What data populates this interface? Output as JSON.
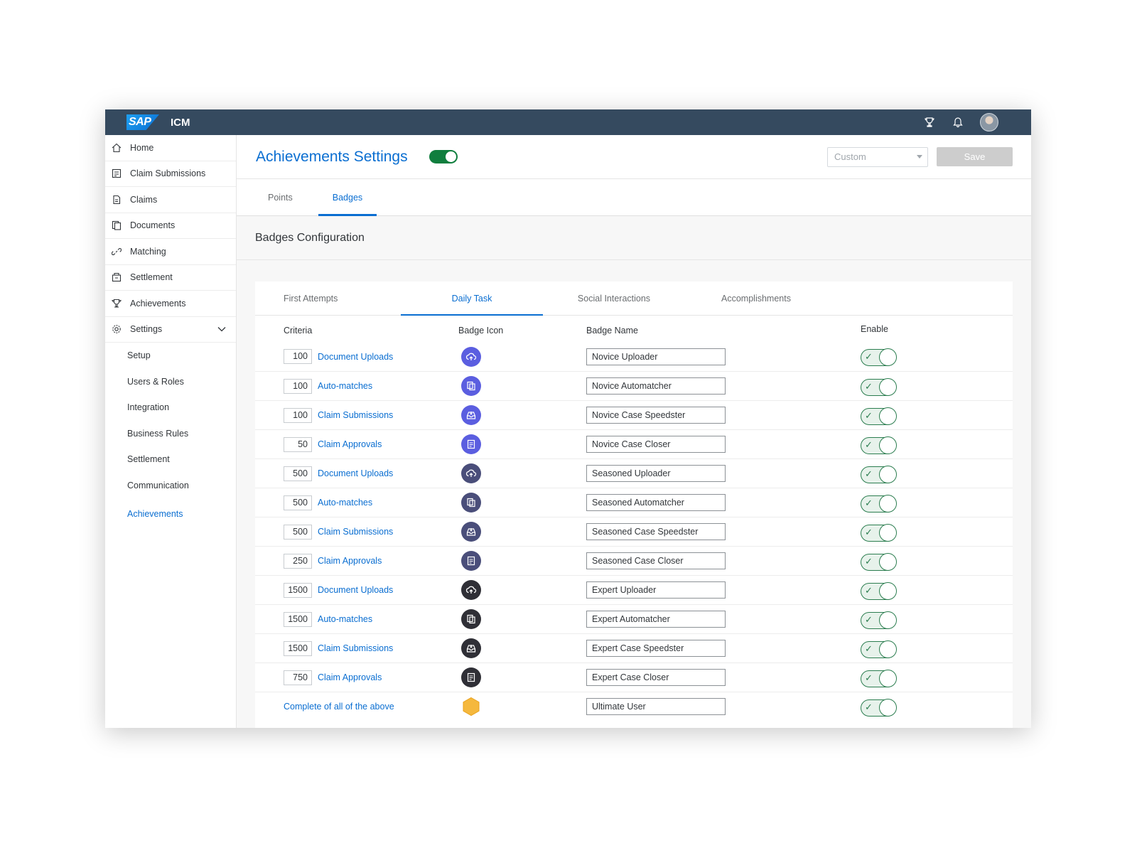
{
  "shell": {
    "logo_text": "SAP",
    "app_name": "ICM"
  },
  "sidebar": {
    "items": [
      {
        "label": "Home",
        "icon": "home-icon"
      },
      {
        "label": "Claim Submissions",
        "icon": "claim-submissions-icon"
      },
      {
        "label": "Claims",
        "icon": "claims-icon"
      },
      {
        "label": "Documents",
        "icon": "documents-icon"
      },
      {
        "label": "Matching",
        "icon": "link-icon"
      },
      {
        "label": "Settlement",
        "icon": "settlement-icon"
      },
      {
        "label": "Achievements",
        "icon": "trophy-icon"
      },
      {
        "label": "Settings",
        "icon": "gear-icon"
      }
    ],
    "sub_items": [
      "Setup",
      "Users & Roles",
      "Integration",
      "Business Rules",
      "Settlement",
      "Communication"
    ],
    "active_sub_item": "Achievements"
  },
  "header": {
    "title": "Achievements Settings",
    "select_value": "Custom",
    "save_label": "Save"
  },
  "tabs": [
    "Points",
    "Badges"
  ],
  "section_title": "Badges Configuration",
  "subtabs": [
    "First Attempts",
    "Daily Task",
    "Social Interactions",
    "Accomplishments"
  ],
  "columns": {
    "criteria": "Criteria",
    "badge_icon": "Badge Icon",
    "badge_name": "Badge Name",
    "enable": "Enable"
  },
  "colors": {
    "novice": "#5b5ee0",
    "seasoned": "#4a4e7a",
    "expert": "#2f2f36",
    "ultimate": "#f5b83d",
    "accent": "#0a6ed1",
    "success": "#107e3e"
  },
  "rows": [
    {
      "count": "100",
      "criterion": "Document Uploads",
      "name": "Novice Uploader",
      "icon": "upload-icon",
      "tier": "novice"
    },
    {
      "count": "100",
      "criterion": "Auto-matches",
      "name": "Novice Automatcher",
      "icon": "documents-icon",
      "tier": "novice"
    },
    {
      "count": "100",
      "criterion": "Claim Submissions",
      "name": "Novice Case Speedster",
      "icon": "inbox-icon",
      "tier": "novice"
    },
    {
      "count": "50",
      "criterion": "Claim Approvals",
      "name": "Novice Case Closer",
      "icon": "approval-icon",
      "tier": "novice"
    },
    {
      "count": "500",
      "criterion": "Document Uploads",
      "name": "Seasoned Uploader",
      "icon": "upload-icon",
      "tier": "seasoned"
    },
    {
      "count": "500",
      "criterion": "Auto-matches",
      "name": "Seasoned Automatcher",
      "icon": "documents-icon",
      "tier": "seasoned"
    },
    {
      "count": "500",
      "criterion": "Claim Submissions",
      "name": "Seasoned Case Speedster",
      "icon": "inbox-icon",
      "tier": "seasoned"
    },
    {
      "count": "250",
      "criterion": "Claim Approvals",
      "name": "Seasoned Case Closer",
      "icon": "approval-icon",
      "tier": "seasoned"
    },
    {
      "count": "1500",
      "criterion": "Document Uploads",
      "name": "Expert Uploader",
      "icon": "upload-icon",
      "tier": "expert"
    },
    {
      "count": "1500",
      "criterion": "Auto-matches",
      "name": "Expert Automatcher",
      "icon": "documents-icon",
      "tier": "expert"
    },
    {
      "count": "1500",
      "criterion": "Claim Submissions",
      "name": "Expert Case Speedster",
      "icon": "inbox-icon",
      "tier": "expert"
    },
    {
      "count": "750",
      "criterion": "Claim Approvals",
      "name": "Expert Case Closer",
      "icon": "approval-icon",
      "tier": "expert"
    },
    {
      "count": "",
      "criterion": "Complete of all of the above",
      "name": "Ultimate User",
      "icon": "hexagon-badge-icon",
      "tier": "ultimate"
    }
  ]
}
